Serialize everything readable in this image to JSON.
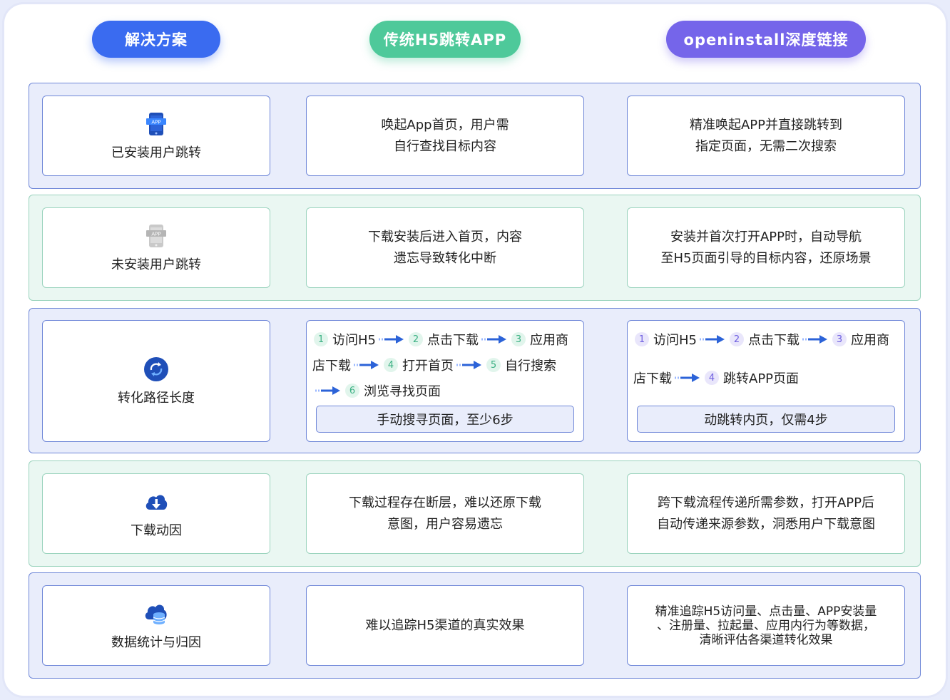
{
  "headers": {
    "solution": "解决方案",
    "h5": "传统H5跳转APP",
    "openinstall": "openinstall深度链接"
  },
  "rows": [
    {
      "label": "已安装用户跳转",
      "icon": "phone-app-icon",
      "h5": [
        "唤起App首页，用户需",
        "自行查找目标内容"
      ],
      "oi": [
        "精准唤起APP并直接跳转到",
        "指定页面，无需二次搜索"
      ]
    },
    {
      "label": "未安装用户跳转",
      "icon": "phone-app-grey-icon",
      "h5": [
        "下载安装后进入首页，内容",
        "遗忘导致转化中断"
      ],
      "oi": [
        "安装并首次打开APP时，自动导航",
        "至H5页面引导的目标内容，还原场景"
      ]
    },
    {
      "label": "转化路径长度",
      "icon": "refresh-arrows-icon",
      "h5_steps": {
        "n1": "1",
        "s1": "访问H5",
        "n2": "2",
        "s2": "点击下载",
        "n3": "3",
        "s3a": "应用商",
        "s3b": "店下载",
        "n4": "4",
        "s4": "打开首页",
        "n5": "5",
        "s5": "自行搜索",
        "n6": "6",
        "s6": "浏览寻找页面"
      },
      "h5_summary": "手动搜寻页面，至少6步",
      "oi_steps": {
        "n1": "1",
        "s1": "访问H5",
        "n2": "2",
        "s2": "点击下载",
        "n3": "3",
        "s3a": "应用商",
        "s3b": "店下载",
        "n4": "4",
        "s4": "跳转APP页面"
      },
      "oi_summary": "动跳转内页，仅需4步"
    },
    {
      "label": "下载动因",
      "icon": "cloud-download-icon",
      "h5": [
        "下载过程存在断层，难以还原下载",
        "意图，用户容易遗忘"
      ],
      "oi": [
        "跨下载流程传递所需参数，打开APP后",
        "自动传递来源参数，洞悉用户下载意图"
      ]
    },
    {
      "label": "数据统计与归因",
      "icon": "cloud-database-icon",
      "h5": [
        "难以追踪H5渠道的真实效果"
      ],
      "oi": [
        "精准追踪H5访问量、点击量、APP安装量",
        "、注册量、拉起量、应用内行为等数据，",
        "清晰评估各渠道转化效果"
      ]
    }
  ],
  "colors": {
    "blue": "#3a6bf0",
    "green": "#4ec99a",
    "purple": "#7565ea",
    "row_blue_bg": "#e9edfb",
    "row_green_bg": "#eaf7f2"
  }
}
